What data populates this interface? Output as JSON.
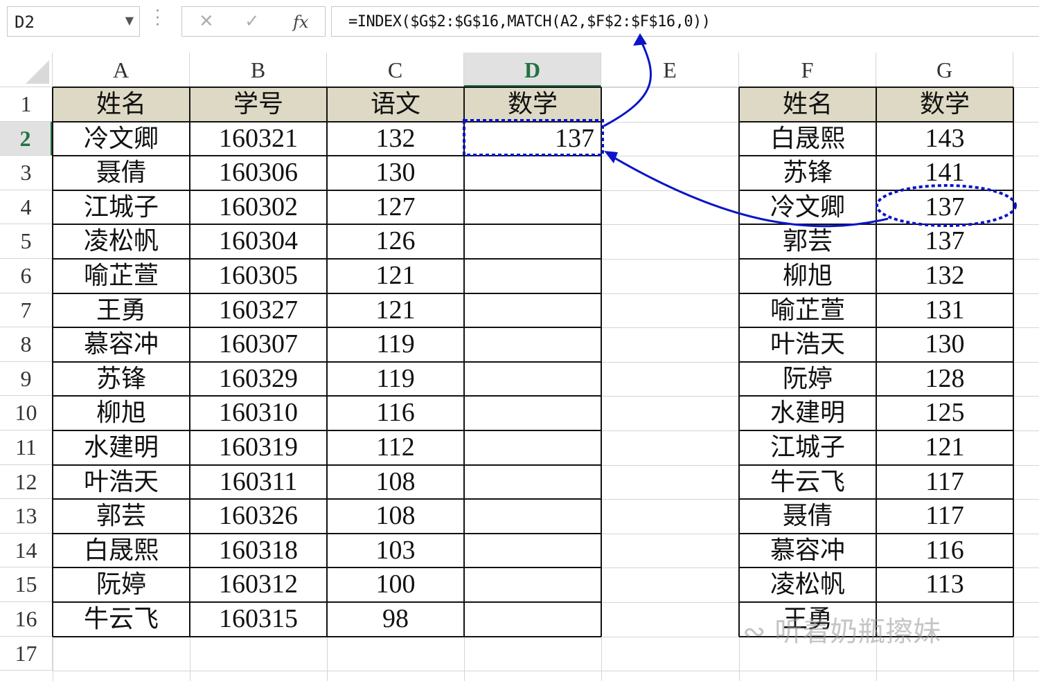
{
  "formula_bar": {
    "name_box": "D2",
    "cancel_icon": "✕",
    "enter_icon": "✓",
    "fx_label": "fx",
    "formula": "=INDEX($G$2:$G$16,MATCH(A2,$F$2:$F$16,0))"
  },
  "columns": [
    "A",
    "B",
    "C",
    "D",
    "E",
    "F",
    "G"
  ],
  "rows": [
    "1",
    "2",
    "3",
    "4",
    "5",
    "6",
    "7",
    "8",
    "9",
    "10",
    "11",
    "12",
    "13",
    "14",
    "15",
    "16",
    "17"
  ],
  "left_table": {
    "headers": [
      "姓名",
      "学号",
      "语文",
      "数学"
    ],
    "rows": [
      [
        "冷文卿",
        "160321",
        "132",
        "137"
      ],
      [
        "聂倩",
        "160306",
        "130",
        ""
      ],
      [
        "江城子",
        "160302",
        "127",
        ""
      ],
      [
        "凌松帆",
        "160304",
        "126",
        ""
      ],
      [
        "喻芷萱",
        "160305",
        "121",
        ""
      ],
      [
        "王勇",
        "160327",
        "121",
        ""
      ],
      [
        "慕容冲",
        "160307",
        "119",
        ""
      ],
      [
        "苏锋",
        "160329",
        "119",
        ""
      ],
      [
        "柳旭",
        "160310",
        "116",
        ""
      ],
      [
        "水建明",
        "160319",
        "112",
        ""
      ],
      [
        "叶浩天",
        "160311",
        "108",
        ""
      ],
      [
        "郭芸",
        "160326",
        "108",
        ""
      ],
      [
        "白晟熙",
        "160318",
        "103",
        ""
      ],
      [
        "阮婷",
        "160312",
        "100",
        ""
      ],
      [
        "牛云飞",
        "160315",
        "98",
        ""
      ]
    ]
  },
  "right_table": {
    "headers": [
      "姓名",
      "数学"
    ],
    "rows": [
      [
        "白晟熙",
        "143"
      ],
      [
        "苏锋",
        "141"
      ],
      [
        "冷文卿",
        "137"
      ],
      [
        "郭芸",
        "137"
      ],
      [
        "柳旭",
        "132"
      ],
      [
        "喻芷萱",
        "131"
      ],
      [
        "叶浩天",
        "130"
      ],
      [
        "阮婷",
        "128"
      ],
      [
        "水建明",
        "125"
      ],
      [
        "江城子",
        "121"
      ],
      [
        "牛云飞",
        "117"
      ],
      [
        "聂倩",
        "117"
      ],
      [
        "慕容冲",
        "116"
      ],
      [
        "凌松帆",
        "113"
      ],
      [
        "王勇",
        ""
      ]
    ]
  },
  "watermark": "听着奶瓶擦妹",
  "annotation_color": "#0a14c8",
  "header_fill": "#ddd9c4",
  "selection_color": "#217346"
}
